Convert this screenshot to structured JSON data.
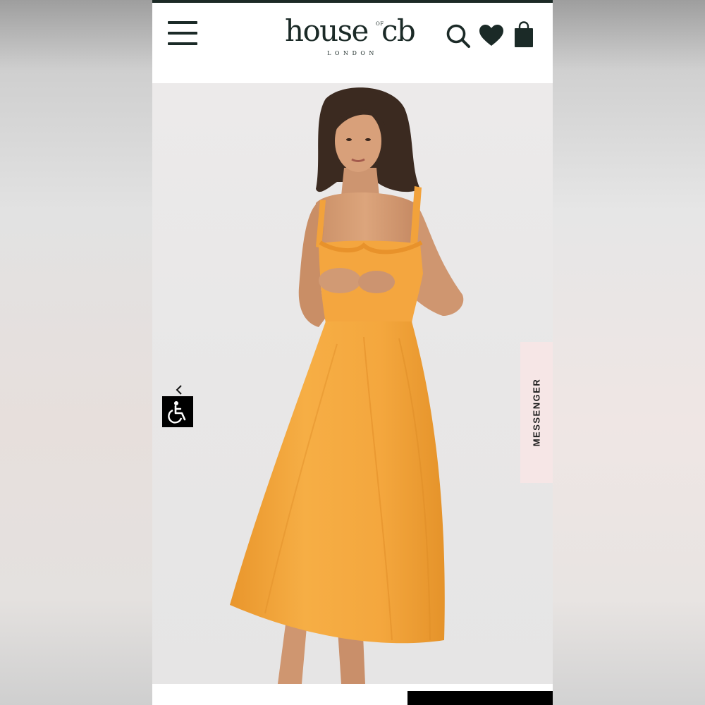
{
  "header": {
    "brand": "house",
    "brand_of": "OF",
    "brand_end": "cb",
    "brand_sub": "LONDON"
  },
  "icons": {
    "menu": "hamburger-menu-icon",
    "search": "search-icon",
    "wishlist": "heart-icon",
    "bag": "shopping-bag-icon",
    "accessibility": "accessibility-icon",
    "collapse": "chevron-left-icon"
  },
  "messenger": {
    "label": "MESSENGER"
  },
  "colors": {
    "brand": "#1b2a27",
    "dress": "#f6ae45",
    "background": "#e9e8e8",
    "messenger_bg": "#f6e6e6"
  }
}
